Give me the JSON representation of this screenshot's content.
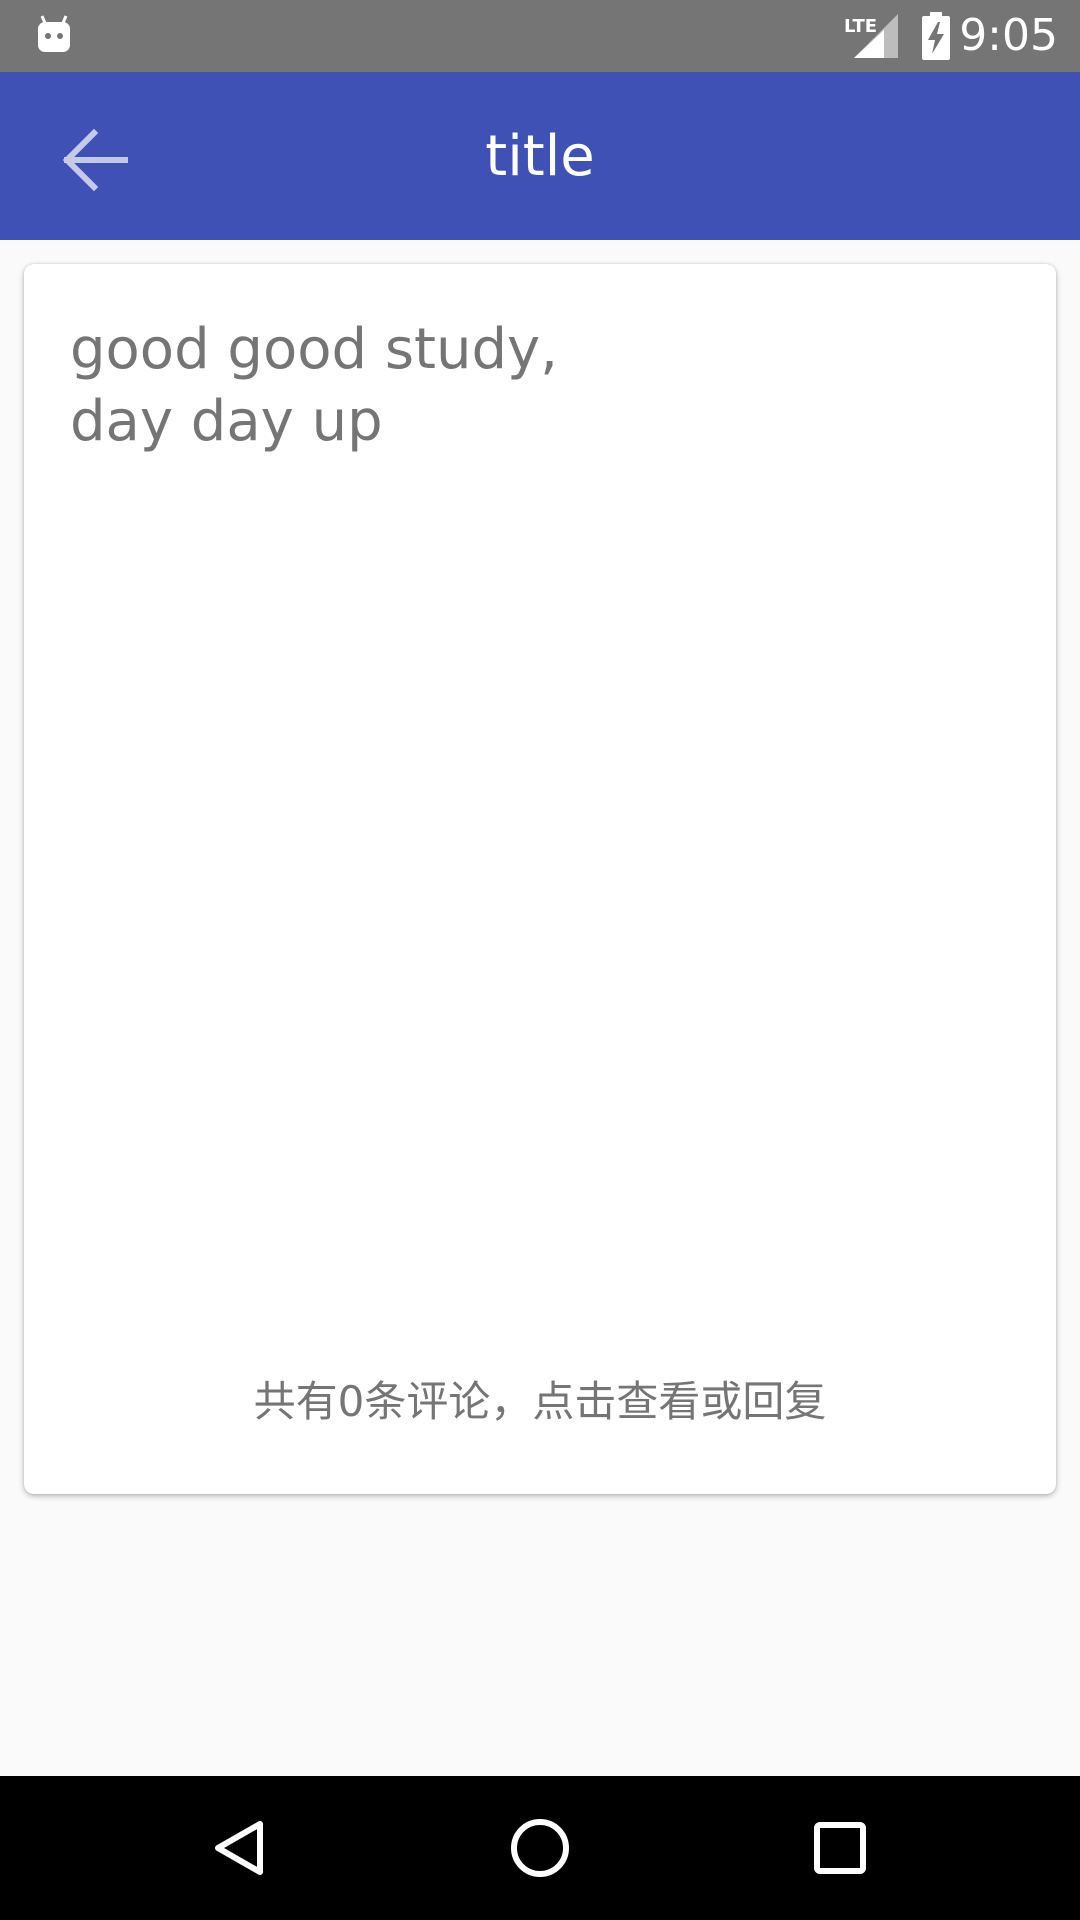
{
  "status_bar": {
    "time": "9:05",
    "network_label": "LTE",
    "icons": [
      "android-notification-icon",
      "lte-signal-icon",
      "battery-charging-icon"
    ]
  },
  "app_bar": {
    "title": "title",
    "back_icon": "arrow-back-icon",
    "background_color": "#3f51b5"
  },
  "post": {
    "content": "good good study,\nday day up",
    "comments_link": "共有0条评论，点击查看或回复"
  },
  "nav_bar": {
    "buttons": [
      "back-triangle-icon",
      "home-circle-icon",
      "recents-square-icon"
    ]
  }
}
